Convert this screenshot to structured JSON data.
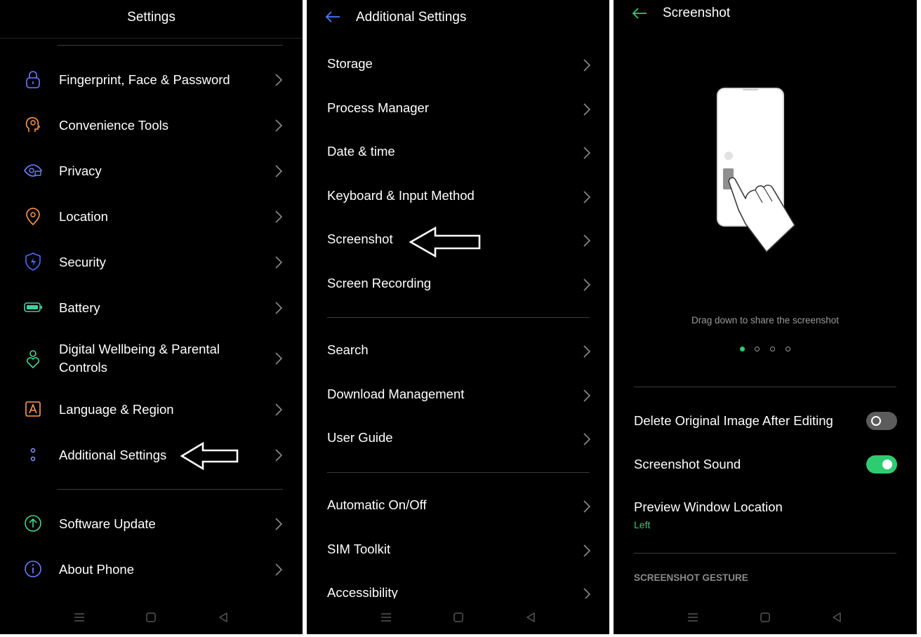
{
  "panel1": {
    "title": "Settings",
    "items": [
      {
        "label": "Fingerprint, Face & Password",
        "icon": "lock-icon",
        "color": "#6b7cff"
      },
      {
        "label": "Convenience Tools",
        "icon": "head-icon",
        "color": "#ff9a55"
      },
      {
        "label": "Privacy",
        "icon": "eye-lock-icon",
        "color": "#6b7cff"
      },
      {
        "label": "Location",
        "icon": "location-pin-icon",
        "color": "#ff9a55"
      },
      {
        "label": "Security",
        "icon": "shield-icon",
        "color": "#4a6cff"
      },
      {
        "label": "Battery",
        "icon": "battery-icon",
        "color": "#3fd2a0"
      },
      {
        "label": "Digital Wellbeing & Parental",
        "label2": "Controls",
        "icon": "wellbeing-icon",
        "color": "#47d58b"
      },
      {
        "label": "Language & Region",
        "icon": "language-icon",
        "color": "#ff9a55"
      },
      {
        "label": "Additional Settings",
        "icon": "more-icon",
        "color": "#8a93ff"
      },
      {
        "label": "Software Update",
        "icon": "update-icon",
        "color": "#47d58b"
      },
      {
        "label": "About Phone",
        "icon": "info-icon",
        "color": "#6b7cff"
      }
    ]
  },
  "panel2": {
    "title": "Additional Settings",
    "groups": [
      [
        "Storage",
        "Process Manager",
        "Date & time",
        "Keyboard & Input Method",
        "Screenshot",
        "Screen Recording"
      ],
      [
        "Search",
        "Download Management",
        "User Guide"
      ],
      [
        "Automatic On/Off",
        "SIM Toolkit",
        "Accessibility"
      ]
    ]
  },
  "panel3": {
    "title": "Screenshot",
    "caption": "Drag down to share the screenshot",
    "pager": {
      "count": 4,
      "active": 0
    },
    "delete_label": "Delete Original Image After Editing",
    "delete_on": false,
    "sound_label": "Screenshot Sound",
    "sound_on": true,
    "preview_label": "Preview Window Location",
    "preview_value": "Left",
    "gesture_header": "SCREENSHOT GESTURE"
  },
  "colors": {
    "accent": "#2ecc71",
    "background": "#000000"
  }
}
